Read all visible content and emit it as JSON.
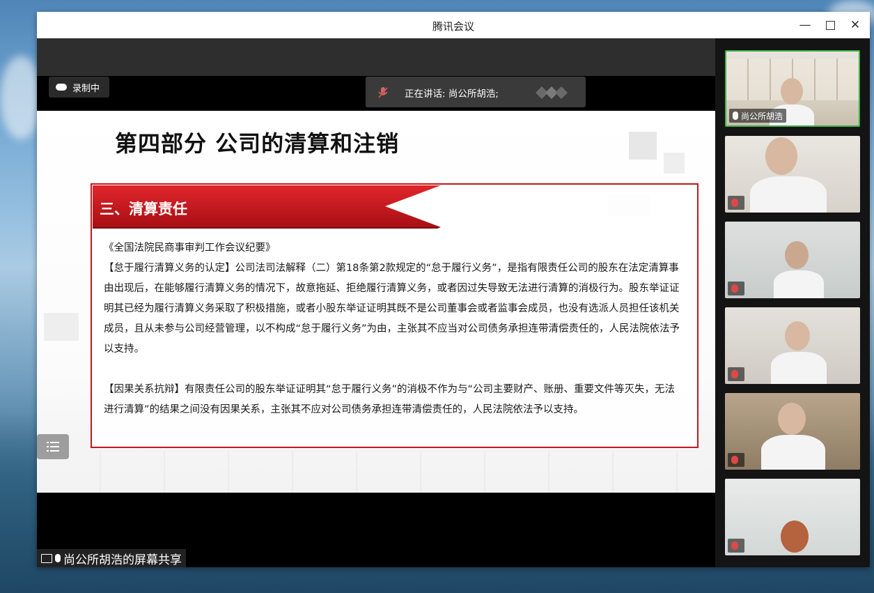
{
  "window": {
    "title": "腾讯会议",
    "minimize_icon": "minimize-icon",
    "maximize_icon": "maximize-icon",
    "close_icon": "close-icon"
  },
  "recording": {
    "label": "录制中",
    "icon": "cloud-icon"
  },
  "speaking": {
    "label": "正在讲话: 尚公所胡浩;",
    "icon": "mic-muted-icon"
  },
  "slide": {
    "title": "第四部分 公司的清算和注销",
    "section": "三、清算责任",
    "source": "《全国法院民商事审判工作会议纪要》",
    "paragraph1": "【怠于履行清算义务的认定】公司法司法解释（二）第18条第2款规定的“怠于履行义务”，是指有限责任公司的股东在法定清算事由出现后，在能够履行清算义务的情况下，故意拖延、拒绝履行清算义务，或者因过失导致无法进行清算的消极行为。股东举证证明其已经为履行清算义务采取了积极措施，或者小股东举证证明其既不是公司董事会或者监事会成员，也没有选派人员担任该机关成员，且从未参与公司经营管理，以不构成“怠于履行义务”为由，主张其不应当对公司债务承担连带清偿责任的，人民法院依法予以支持。",
    "paragraph2": "【因果关系抗辩】有限责任公司的股东举证证明其“怠于履行义务”的消极不作为与“公司主要财产、账册、重要文件等灭失，无法进行清算”的结果之间没有因果关系，主张其不应对公司债务承担连带清偿责任的，人民法院依法予以支持。"
  },
  "share_label": "尚公所胡浩的屏幕共享",
  "participants": [
    {
      "name": "尚公所胡浩",
      "active": true,
      "mic": "mic-on"
    },
    {
      "name": "",
      "active": false,
      "mic": "mic-muted"
    },
    {
      "name": "",
      "active": false,
      "mic": "mic-muted"
    },
    {
      "name": "",
      "active": false,
      "mic": "mic-muted"
    },
    {
      "name": "",
      "active": false,
      "mic": "mic-muted"
    },
    {
      "name": "",
      "active": false,
      "mic": "mic-muted"
    }
  ],
  "colors": {
    "accent_red": "#c4161c",
    "active_border": "#3db34a"
  }
}
